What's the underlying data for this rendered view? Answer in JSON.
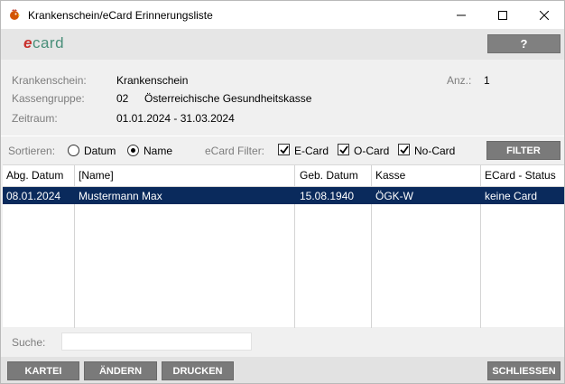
{
  "window": {
    "title": "Krankenschein/eCard Erinnerungsliste",
    "icon": "rooster-icon"
  },
  "logo": {
    "e": "e",
    "rest": "card"
  },
  "help": {
    "label": "?"
  },
  "info": {
    "krankenschein_label": "Krankenschein:",
    "krankenschein_value": "Krankenschein",
    "kassengruppe_label": "Kassengruppe:",
    "kassengruppe_code": "02",
    "kassengruppe_name": "Österreichische Gesundheitskasse",
    "zeitraum_label": "Zeitraum:",
    "zeitraum_value": "01.01.2024 - 31.03.2024",
    "anz_label": "Anz.:",
    "anz_value": "1"
  },
  "filter": {
    "sort_label": "Sortieren:",
    "sort_options": [
      {
        "label": "Datum",
        "selected": false
      },
      {
        "label": "Name",
        "selected": true
      }
    ],
    "ecard_filter_label": "eCard Filter:",
    "checkboxes": [
      {
        "label": "E-Card",
        "checked": true
      },
      {
        "label": "O-Card",
        "checked": true
      },
      {
        "label": "No-Card",
        "checked": true
      }
    ],
    "button_label": "FILTER"
  },
  "table": {
    "columns": [
      "Abg. Datum",
      "[Name]",
      "Geb. Datum",
      "Kasse",
      "ECard - Status"
    ],
    "rows": [
      [
        "08.01.2024",
        "Mustermann Max",
        "15.08.1940",
        "ÖGK-W",
        "keine Card"
      ]
    ],
    "selected_row_color": "#0a2a5c"
  },
  "search": {
    "label": "Suche:",
    "value": "",
    "placeholder": ""
  },
  "buttons": {
    "kartei": "KARTEI",
    "aendern": "ÄNDERN",
    "drucken": "DRUCKEN",
    "schliessen": "SCHLIESSEN"
  },
  "colors": {
    "button_bg": "#7a7a7a",
    "logo_e": "#c9302c",
    "logo_card": "#4a8f7a"
  }
}
